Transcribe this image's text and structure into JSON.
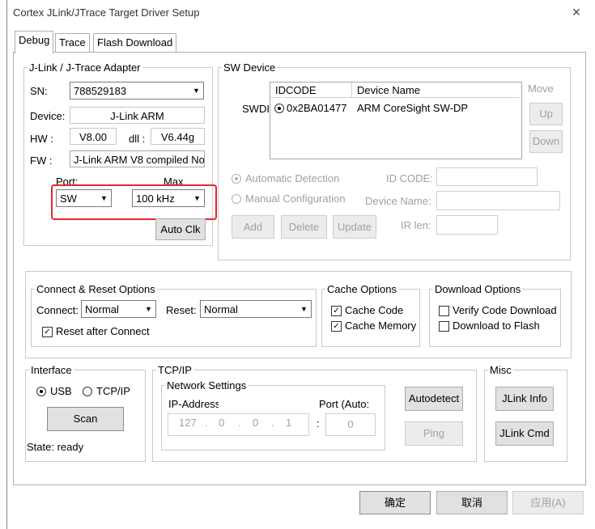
{
  "window": {
    "title": "Cortex JLink/JTrace Target Driver Setup",
    "close_glyph": "×"
  },
  "tabs": [
    "Debug",
    "Trace",
    "Flash Download"
  ],
  "adapter": {
    "legend": "J-Link / J-Trace Adapter",
    "sn_label": "SN:",
    "sn_value": "788529183",
    "device_label": "Device:",
    "device_value": "J-Link ARM",
    "hw_label": "HW :",
    "hw_value": "V8.00",
    "dll_label": "dll :",
    "dll_value": "V6.44g",
    "fw_label": "FW :",
    "fw_value": "J-Link ARM V8 compiled No",
    "port_label": "Port:",
    "port_value": "SW",
    "max_label": "Max",
    "max_value": "100 kHz",
    "autoclk_label": "Auto Clk",
    "highlight_color": "#e8262b"
  },
  "sw_device": {
    "legend": "SW Device",
    "swd_label": "SWDI",
    "col_idcode": "IDCODE",
    "col_name": "Device Name",
    "rows": [
      {
        "idcode": "0x2BA01477",
        "name": "ARM CoreSight SW-DP"
      }
    ],
    "move_label": "Move",
    "up_label": "Up",
    "down_label": "Down",
    "auto_detect": "Automatic Detection",
    "manual_config": "Manual Configuration",
    "id_code_label": "ID CODE:",
    "device_name_label": "Device Name:",
    "ir_len_label": "IR len:",
    "add_label": "Add",
    "delete_label": "Delete",
    "update_label": "Update"
  },
  "connect_reset": {
    "legend": "Connect & Reset Options",
    "connect_label": "Connect:",
    "connect_value": "Normal",
    "reset_label": "Reset:",
    "reset_value": "Normal",
    "reset_after_connect": "Reset after Connect"
  },
  "cache": {
    "legend": "Cache Options",
    "cache_code": "Cache Code",
    "cache_memory": "Cache Memory"
  },
  "download": {
    "legend": "Download Options",
    "verify": "Verify Code Download",
    "to_flash": "Download to Flash"
  },
  "interface": {
    "legend": "Interface",
    "usb": "USB",
    "tcpip": "TCP/IP",
    "scan_label": "Scan",
    "state": "State: ready"
  },
  "tcpip": {
    "legend": "TCP/IP",
    "net_legend": "Network Settings",
    "ip_label": "IP-Address",
    "port_label": "Port (Auto:",
    "ip1": "127",
    "ip2": "0",
    "ip3": "0",
    "ip4": "1",
    "port_value": "0",
    "dot": ".",
    "colon": ":",
    "autodetect_label": "Autodetect",
    "ping_label": "Ping"
  },
  "misc": {
    "legend": "Misc",
    "jlink_info": "JLink Info",
    "jlink_cmd": "JLink Cmd"
  },
  "footer": {
    "ok": "确定",
    "cancel": "取消",
    "apply": "应用(A)"
  },
  "check_glyph": "✓",
  "arrow_glyph": "▼"
}
